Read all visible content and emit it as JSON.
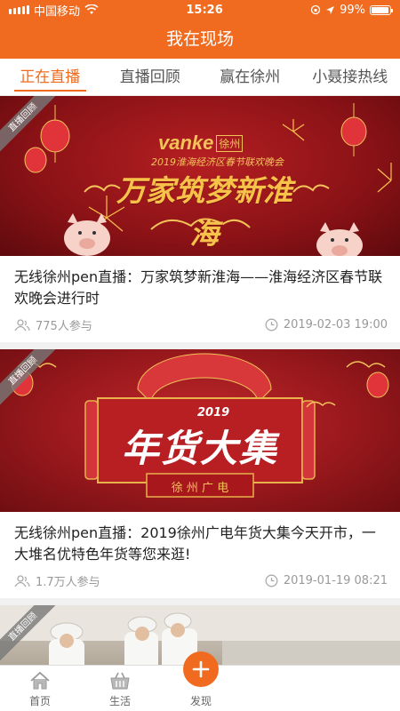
{
  "status_bar": {
    "carrier": "中国移动",
    "time": "15:26",
    "battery": "99%"
  },
  "header": {
    "title": "我在现场"
  },
  "tabs": [
    {
      "label": "正在直播",
      "active": true
    },
    {
      "label": "直播回顾",
      "active": false
    },
    {
      "label": "赢在徐州",
      "active": false
    },
    {
      "label": "小聂接热线",
      "active": false
    }
  ],
  "cards": [
    {
      "corner_label": "直播回顾",
      "banner": {
        "brand": "vanke",
        "brand_city": "徐州",
        "subtitle": "2019淮海经济区春节联欢晚会",
        "headline": "万家筑梦新淮海"
      },
      "title": "无线徐州pen直播：万家筑梦新淮海——淮海经济区春节联欢晚会进行时",
      "participants": "775人参与",
      "date": "2019-02-03 19:00"
    },
    {
      "corner_label": "直播回顾",
      "banner": {
        "year": "2019",
        "headline": "年货大集",
        "subtitle": "徐 州 广 电"
      },
      "title": "无线徐州pen直播：2019徐州广电年货大集今天开市，一大堆名优特色年货等您来逛!",
      "participants": "1.7万人参与",
      "date": "2019-01-19 08:21"
    },
    {
      "corner_label": "直播回顾"
    }
  ],
  "tabbar": {
    "home": "首页",
    "life": "生活",
    "discover": "发现"
  }
}
